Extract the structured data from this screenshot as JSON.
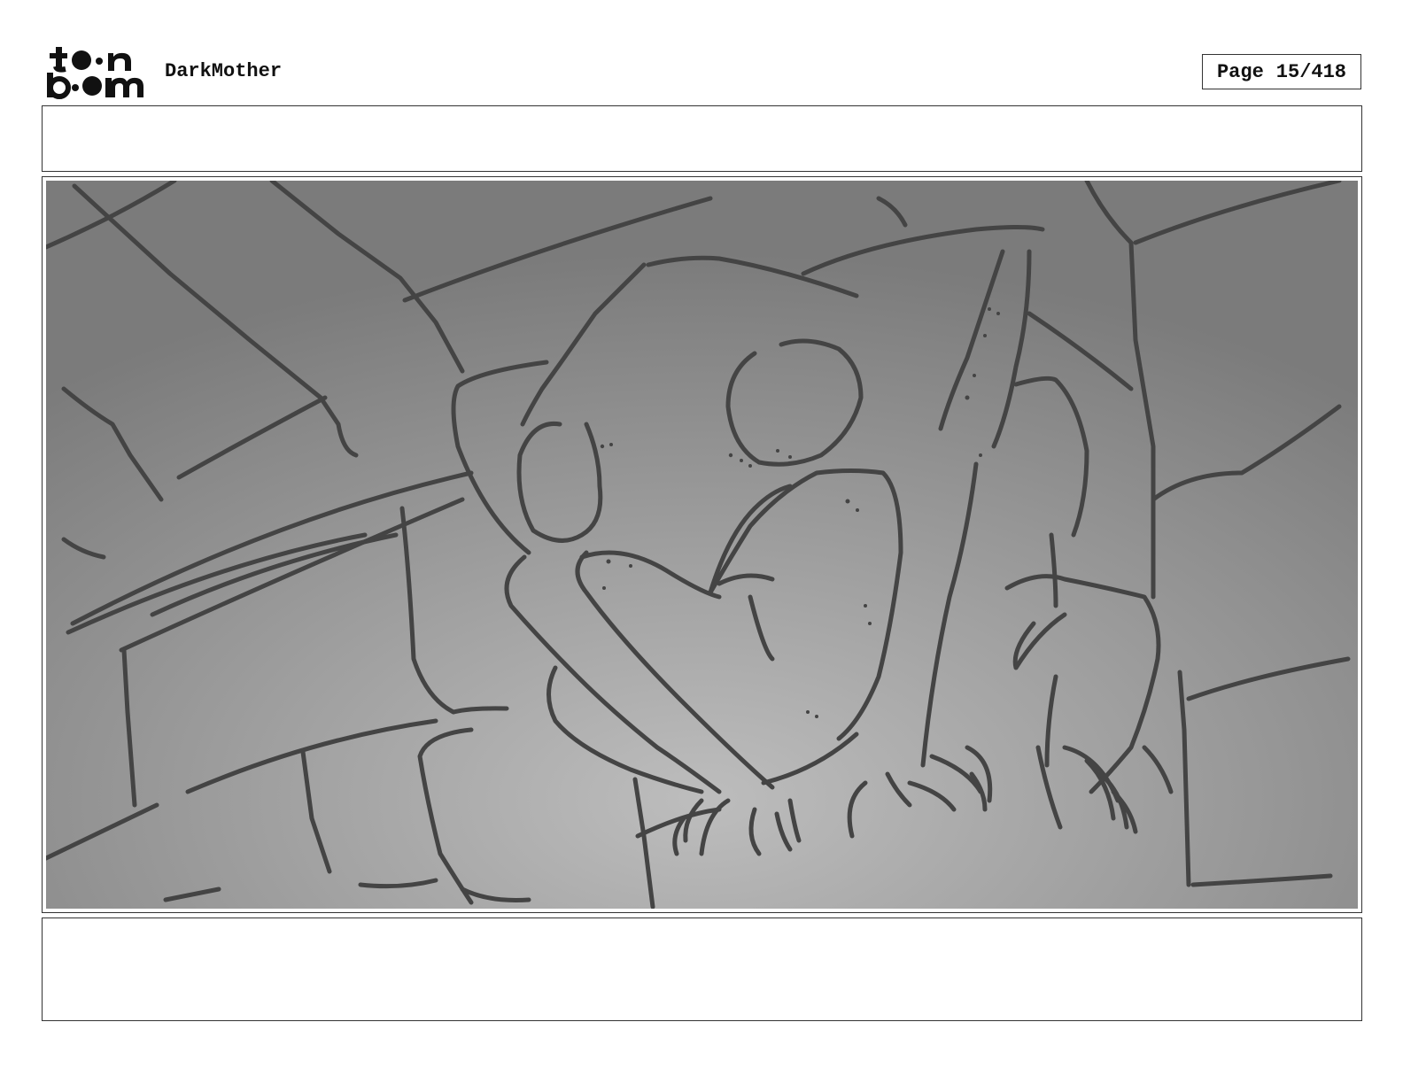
{
  "header": {
    "logo_name": "toon-boom-logo",
    "project_title": "DarkMother",
    "page_label": "Page",
    "page_number": "15/418"
  },
  "panel": {
    "dialogue": "",
    "action_notes": "",
    "colors": {
      "background_center": "#bdbdbd",
      "background_edge": "#7b7b7b",
      "line": "#444444"
    }
  }
}
